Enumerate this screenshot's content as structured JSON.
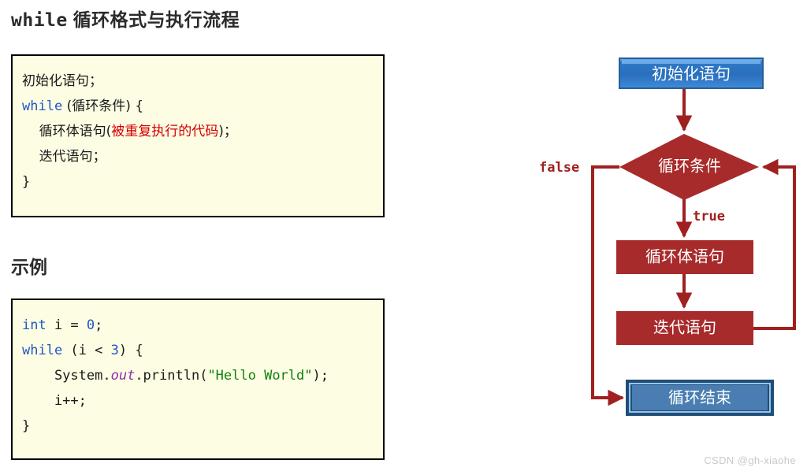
{
  "page": {
    "title_mono": "while",
    "title_cjk": " 循环格式与执行流程",
    "example_heading": "示例",
    "watermark": "CSDN @gh-xiaohe"
  },
  "colors": {
    "code_bg": "#FDFDE3",
    "code_border": "#000000",
    "keyword": "#1F57C8",
    "number": "#1F57C8",
    "string": "#108010",
    "field": "#8A2EA8",
    "highlight_red": "#D40000",
    "flow_red": "#A02020",
    "flow_box_red": "#A82B2B",
    "flow_blue_start": "#2E79C7",
    "flow_blue_end": "#4A7EB2",
    "flow_blue_border": "#1F4E79",
    "heading": "#2B2B2B",
    "watermark": "#C9C9C9"
  },
  "syntax_block": {
    "lines": [
      {
        "segments": [
          {
            "text": "初始化语句；",
            "style": "cjk"
          }
        ]
      },
      {
        "segments": [
          {
            "text": "while",
            "style": "kw"
          },
          {
            "text": " (循环条件) {",
            "style": "cjk"
          }
        ]
      },
      {
        "segments": [
          {
            "text": "    循环体语句(",
            "style": "cjk"
          },
          {
            "text": "被重复执行的代码",
            "style": "hl"
          },
          {
            "text": ")；",
            "style": "cjk"
          }
        ]
      },
      {
        "segments": [
          {
            "text": "    迭代语句；",
            "style": "cjk"
          }
        ]
      },
      {
        "segments": [
          {
            "text": "}",
            "style": "plain"
          }
        ]
      }
    ]
  },
  "example_block": {
    "lines": [
      {
        "segments": [
          {
            "text": "int",
            "style": "kw"
          },
          {
            "text": " i = ",
            "style": "plain"
          },
          {
            "text": "0",
            "style": "num"
          },
          {
            "text": ";",
            "style": "plain"
          }
        ]
      },
      {
        "segments": [
          {
            "text": "while",
            "style": "kw"
          },
          {
            "text": " (i < ",
            "style": "plain"
          },
          {
            "text": "3",
            "style": "num"
          },
          {
            "text": ") {",
            "style": "plain"
          }
        ]
      },
      {
        "segments": [
          {
            "text": "    System.",
            "style": "plain"
          },
          {
            "text": "out",
            "style": "fld"
          },
          {
            "text": ".println(",
            "style": "plain"
          },
          {
            "text": "\"Hello World\"",
            "style": "str"
          },
          {
            "text": ");",
            "style": "plain"
          }
        ]
      },
      {
        "segments": [
          {
            "text": "    i++;",
            "style": "plain"
          }
        ]
      },
      {
        "segments": [
          {
            "text": "}",
            "style": "plain"
          }
        ]
      }
    ]
  },
  "flowchart": {
    "nodes": {
      "start": "初始化语句",
      "condition": "循环条件",
      "body": "循环体语句",
      "iteration": "迭代语句",
      "end": "循环结束"
    },
    "edges": {
      "false_label": "false",
      "true_label": "true"
    }
  }
}
